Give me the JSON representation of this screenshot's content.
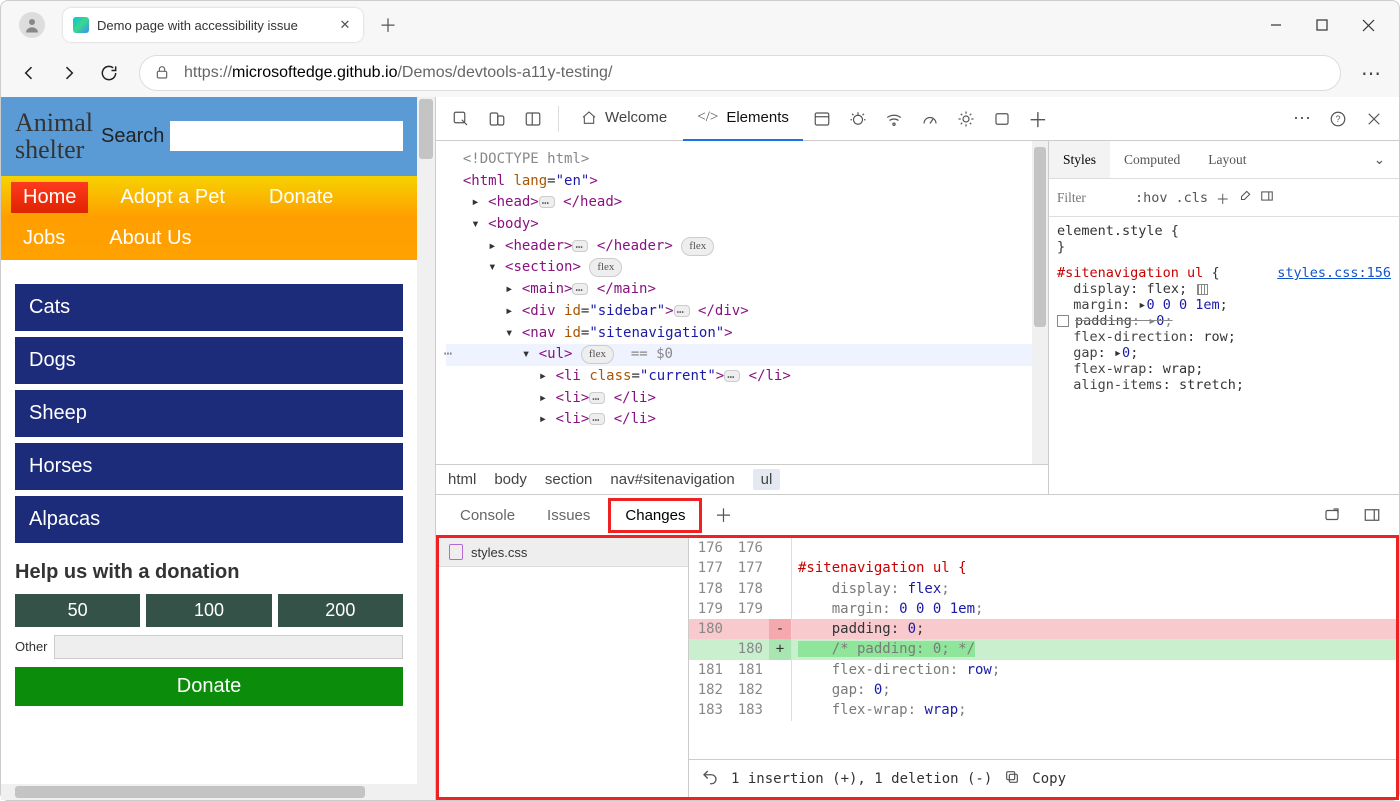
{
  "browser": {
    "tab_title": "Demo page with accessibility issue",
    "url_prefix": "https://",
    "url_host": "microsoftedge.github.io",
    "url_path": "/Demos/devtools-a11y-testing/"
  },
  "page": {
    "logo1": "Animal",
    "logo2": "shelter",
    "search_label": "Search",
    "nav": [
      "Home",
      "Adopt a Pet",
      "Donate",
      "Jobs",
      "About Us"
    ],
    "categories": [
      "Cats",
      "Dogs",
      "Sheep",
      "Horses",
      "Alpacas"
    ],
    "donation_heading": "Help us with a donation",
    "amounts": [
      "50",
      "100",
      "200"
    ],
    "other_label": "Other",
    "donate_btn": "Donate"
  },
  "devtools": {
    "tabs": {
      "welcome": "Welcome",
      "elements": "Elements"
    },
    "dom": {
      "doctype": "<!DOCTYPE html>",
      "html_open": "<html lang=\"en\">",
      "head": "<head>…</head>",
      "body": "<body>",
      "header": "<header>…</header>",
      "flex": "flex",
      "section": "<section>",
      "main": "<main>…</main>",
      "div_sidebar": "<div id=\"sidebar\">…</div>",
      "nav": "<nav id=\"sitenavigation\">",
      "ul": "<ul>",
      "eq0": "== $0",
      "li_current": "<li class=\"current\">…</li>",
      "li": "<li>…</li>"
    },
    "crumbs": [
      "html",
      "body",
      "section",
      "nav#sitenavigation",
      "ul"
    ],
    "styles": {
      "tabs": [
        "Styles",
        "Computed",
        "Layout"
      ],
      "filter": "Filter",
      "hov": ":hov",
      "cls": ".cls",
      "elstyle_open": "element.style {",
      "elstyle_close": "}",
      "rule_selector": "#sitenavigation ul",
      "rule_brace": "  {",
      "source": "styles.css:156",
      "p_display": "display",
      "v_display": "flex",
      "p_margin": "margin",
      "v_margin": "0 0 0 1em",
      "p_padding": "padding",
      "v_padding": "0",
      "p_flexdir": "flex-direction",
      "v_flexdir": "row",
      "p_gap": "gap",
      "v_gap": "0",
      "p_wrap": "flex-wrap",
      "v_wrap": "wrap",
      "p_align": "align-items",
      "v_align": "stretch"
    },
    "drawer": {
      "tabs": [
        "Console",
        "Issues",
        "Changes"
      ],
      "file": "styles.css",
      "selector": "#sitenavigation ul {",
      "l_display": "    display: ",
      "lv_display": "flex",
      "sc": ";",
      "l_margin": "    margin: ",
      "lv_margin": "0 0 0 1em",
      "l_padding": "    padding: ",
      "lv_padding": "0",
      "l_comment": "    /* padding: 0; */",
      "l_flexdir": "    flex-direction: ",
      "lv_flexdir": "row",
      "l_gap": "    gap: ",
      "lv_gap": "0",
      "l_wrap": "    flex-wrap: ",
      "lv_wrap": "wrap",
      "summary": "1 insertion (+), 1 deletion (-)",
      "copy": "Copy",
      "ln": {
        "176": "176",
        "177": "177",
        "178": "178",
        "179": "179",
        "180": "180",
        "181": "181",
        "182": "182",
        "183": "183"
      }
    }
  }
}
